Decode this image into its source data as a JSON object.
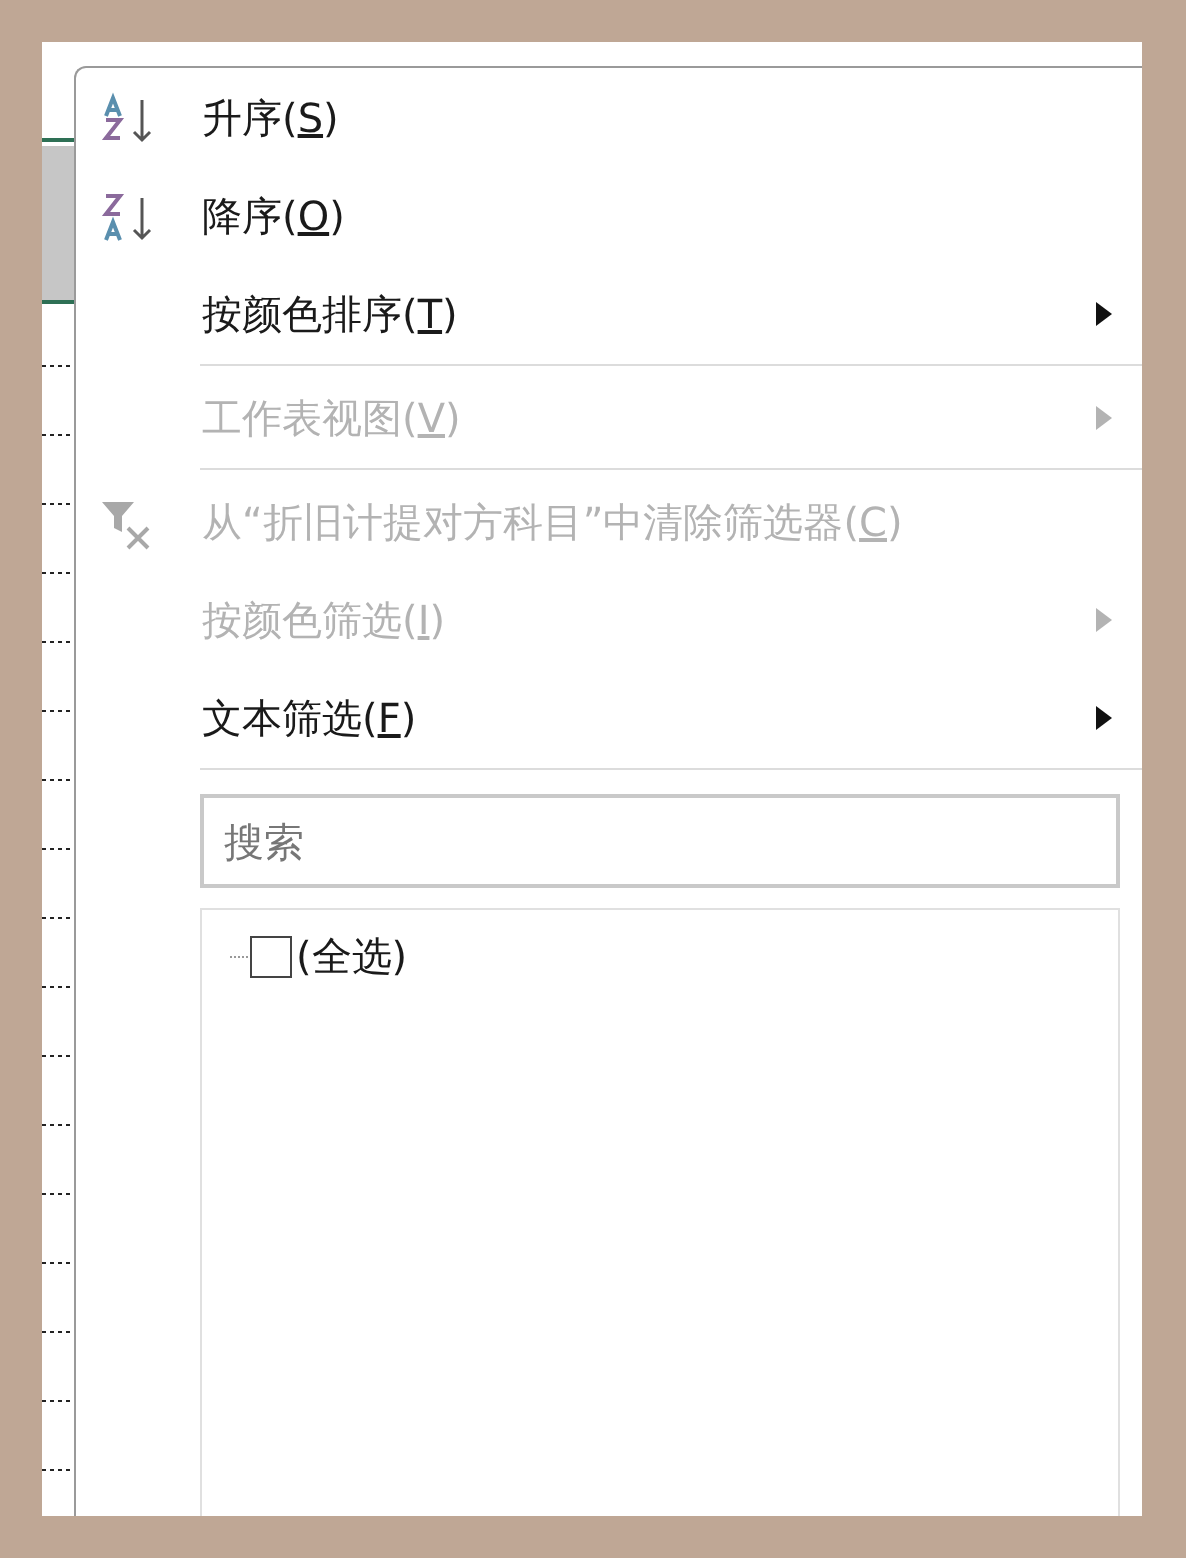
{
  "menu_items": [
    {
      "kind": "ascending",
      "label": {
        "before": "升序(",
        "key": "S",
        "after": ")"
      },
      "disabled": false,
      "submenu": false
    },
    {
      "kind": "descending",
      "label": {
        "before": "降序(",
        "key": "O",
        "after": ")"
      },
      "disabled": false,
      "submenu": false
    },
    {
      "kind": "command",
      "label": {
        "before": "按颜色排序(",
        "key": "T",
        "after": ")"
      },
      "disabled": false,
      "submenu": true
    },
    {
      "kind": "separator"
    },
    {
      "kind": "command",
      "label": {
        "before": "工作表视图(",
        "key": "V",
        "after": ")"
      },
      "disabled": true,
      "submenu": true
    },
    {
      "kind": "separator"
    },
    {
      "kind": "unfilter",
      "label": {
        "before": "从“折旧计提对方科目”中清除筛选器(",
        "key": "C",
        "after": ")"
      },
      "disabled": true,
      "submenu": false
    },
    {
      "kind": "command",
      "label": {
        "before": "按颜色筛选(",
        "key": "I",
        "after": ")"
      },
      "disabled": true,
      "submenu": true
    },
    {
      "kind": "command",
      "label": {
        "before": "文本筛选(",
        "key": "F",
        "after": ")"
      },
      "disabled": false,
      "submenu": true
    },
    {
      "kind": "separator"
    }
  ],
  "search": {
    "placeholder": "搜索"
  },
  "values": [
    {
      "label": "(全选)",
      "checked": false
    }
  ]
}
